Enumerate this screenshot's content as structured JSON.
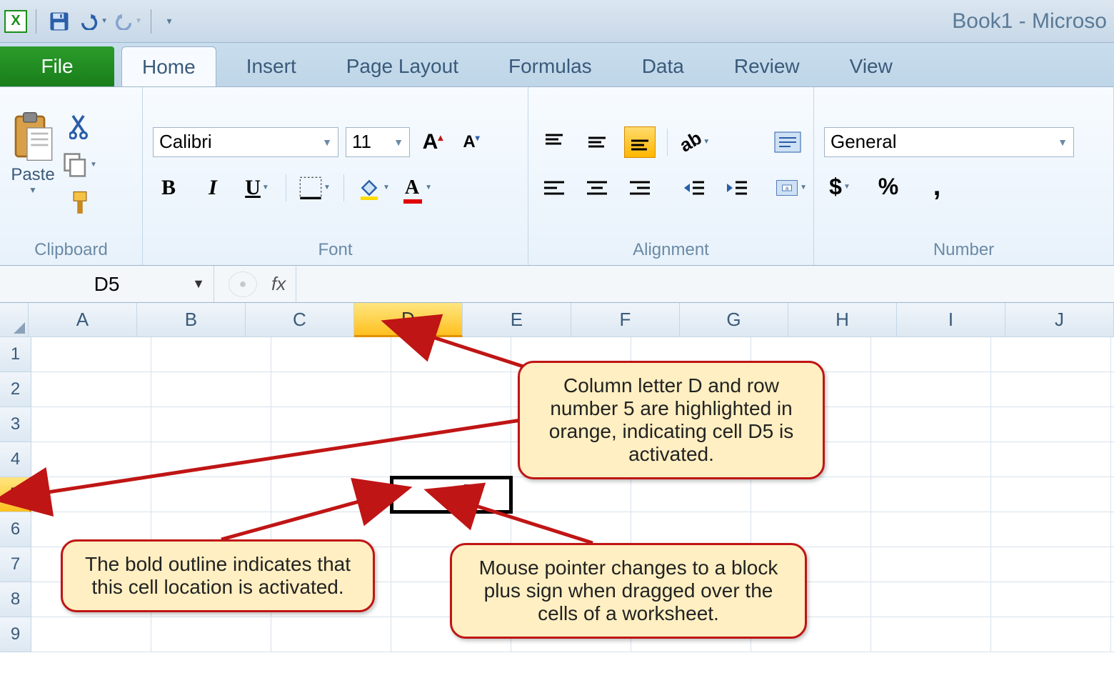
{
  "title": "Book1 - Microso",
  "ribbon": {
    "file_label": "File",
    "tabs": [
      "Home",
      "Insert",
      "Page Layout",
      "Formulas",
      "Data",
      "Review",
      "View"
    ],
    "active_tab": "Home"
  },
  "clipboard": {
    "label": "Clipboard",
    "paste_label": "Paste"
  },
  "font": {
    "label": "Font",
    "name": "Calibri",
    "size": "11"
  },
  "alignment": {
    "label": "Alignment"
  },
  "number": {
    "label": "Number",
    "format": "General"
  },
  "formula_bar": {
    "cell_ref": "D5",
    "fx": "fx"
  },
  "grid": {
    "columns": [
      "A",
      "B",
      "C",
      "D",
      "E",
      "F",
      "G",
      "H",
      "I",
      "J"
    ],
    "rows": [
      "1",
      "2",
      "3",
      "4",
      "5",
      "6",
      "7",
      "8",
      "9"
    ],
    "active_col": "D",
    "active_row": "5"
  },
  "callouts": {
    "c1": "Column letter D and row number 5 are highlighted in orange, indicating cell D5 is activated.",
    "c2": "The bold outline indicates that this cell location is activated.",
    "c3": "Mouse pointer changes to a block plus sign when dragged over the cells of a worksheet."
  }
}
